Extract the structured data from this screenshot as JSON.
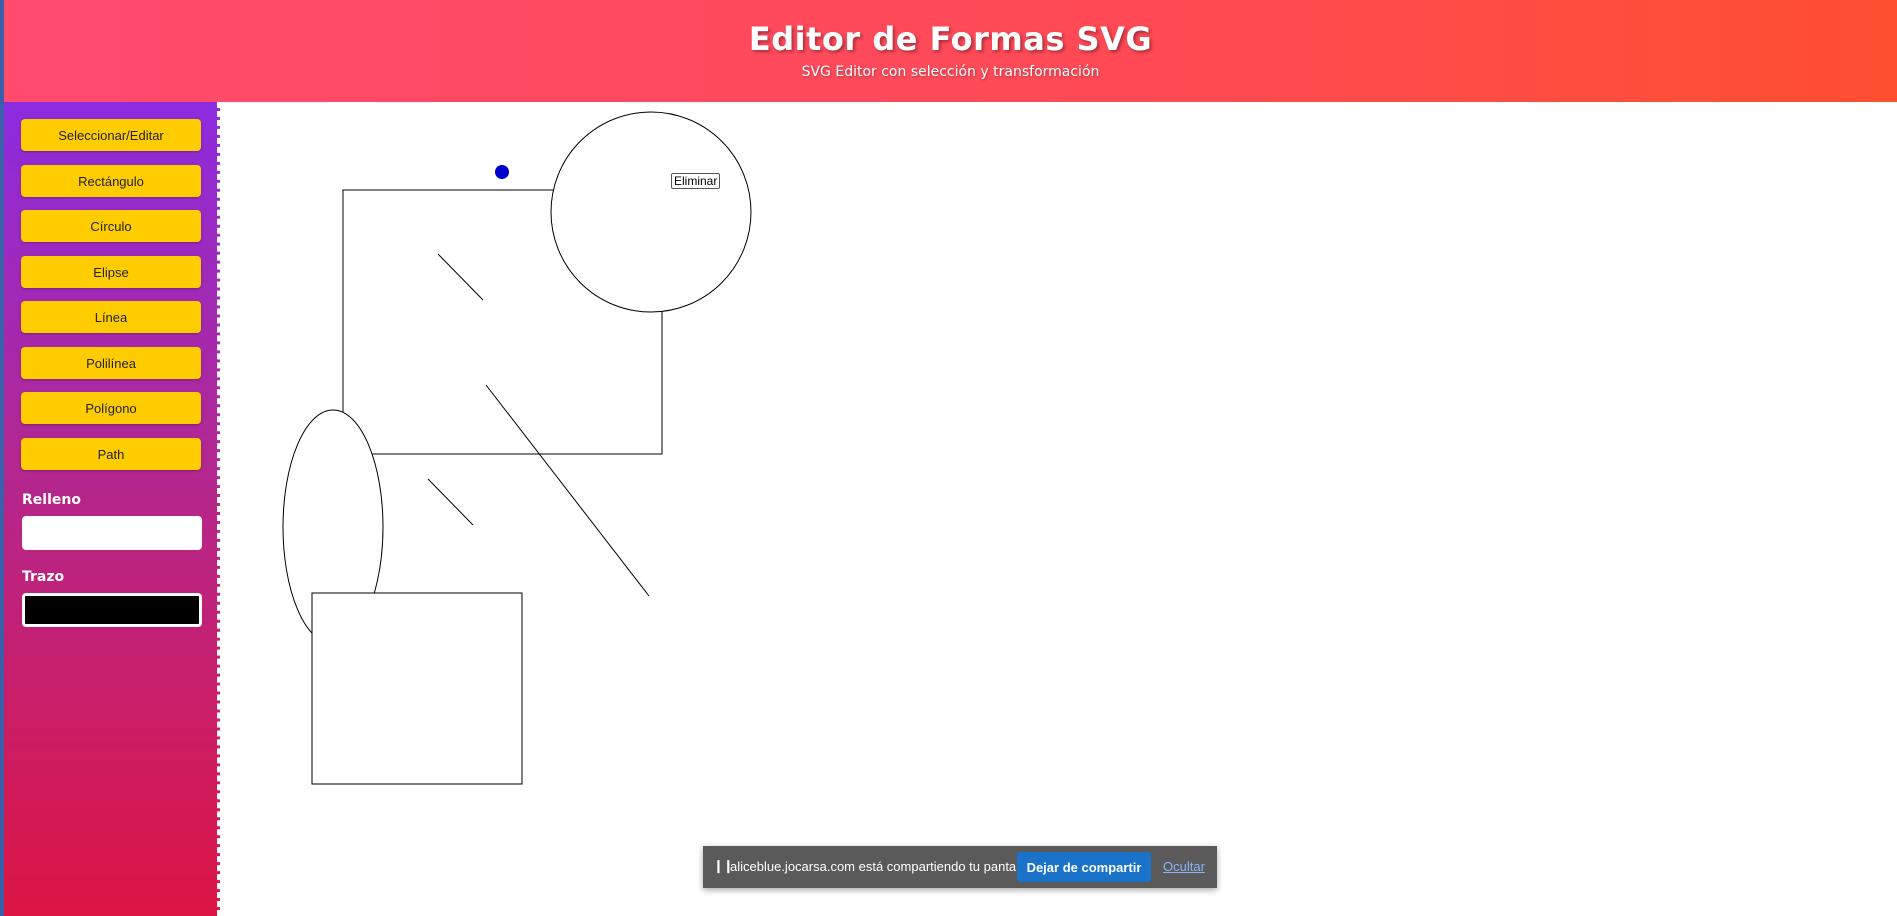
{
  "header": {
    "title": "Editor de Formas SVG",
    "subtitle": "SVG Editor con selección y transformación"
  },
  "toolbar": {
    "tools": [
      {
        "label": "Seleccionar/Editar"
      },
      {
        "label": "Rectángulo"
      },
      {
        "label": "Círculo"
      },
      {
        "label": "Elipse"
      },
      {
        "label": "Línea"
      },
      {
        "label": "Polilínea"
      },
      {
        "label": "Polígono"
      },
      {
        "label": "Path"
      }
    ],
    "fill_label": "Relleno",
    "fill_color": "#ffffff",
    "stroke_label": "Trazo",
    "stroke_color": "#000000"
  },
  "canvas": {
    "delete_label": "Eliminar",
    "handle_color": "#0000cc"
  },
  "share_bar": {
    "message": "aliceblue.jocarsa.com está compartiendo tu pantalla.",
    "stop_label": "Dejar de compartir",
    "hide_label": "Ocultar"
  },
  "colors": {
    "tool_button": "#ffcc00",
    "header_start": "#ff4b6e",
    "header_end": "#ff4f30",
    "sidebar_top": "#8c2be0",
    "sidebar_bottom": "#dc1544"
  }
}
